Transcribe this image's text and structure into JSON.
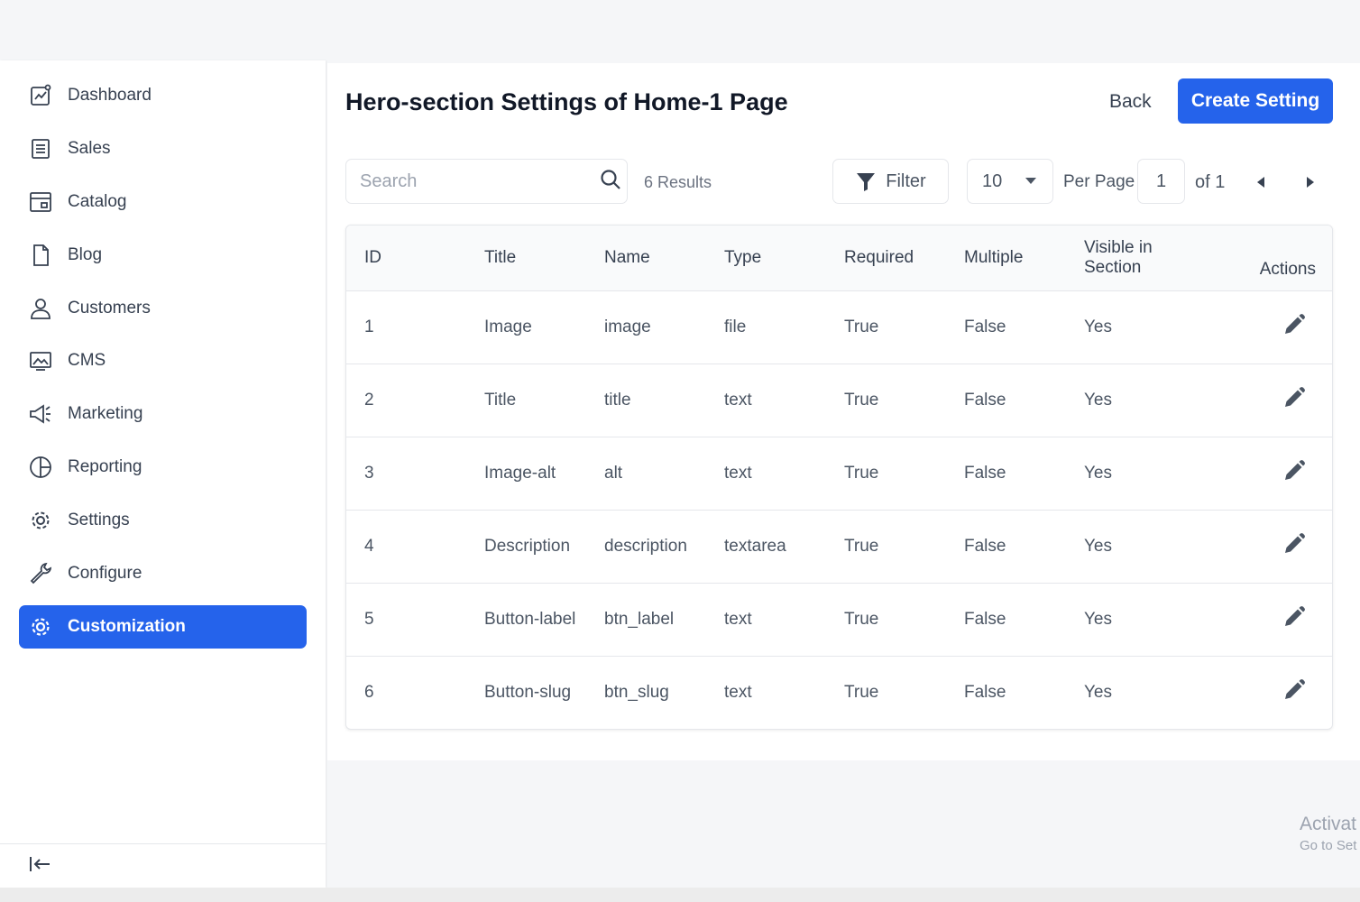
{
  "sidebar": {
    "items": [
      {
        "label": "Dashboard",
        "icon": "dashboard-chart-icon"
      },
      {
        "label": "Sales",
        "icon": "document-list-icon"
      },
      {
        "label": "Catalog",
        "icon": "catalog-window-icon"
      },
      {
        "label": "Blog",
        "icon": "blank-file-icon"
      },
      {
        "label": "Customers",
        "icon": "user-icon"
      },
      {
        "label": "CMS",
        "icon": "image-monitor-icon"
      },
      {
        "label": "Marketing",
        "icon": "megaphone-icon"
      },
      {
        "label": "Reporting",
        "icon": "pie-chart-icon"
      },
      {
        "label": "Settings",
        "icon": "gear-icon"
      },
      {
        "label": "Configure",
        "icon": "wrench-icon"
      },
      {
        "label": "Customization",
        "icon": "gear-icon",
        "active": true
      }
    ],
    "collapse_icon": "collapse-left-icon"
  },
  "header": {
    "title": "Hero-section Settings of Home-1 Page",
    "back_label": "Back",
    "create_label": "Create Setting"
  },
  "toolbar": {
    "search_placeholder": "Search",
    "results": "6 Results",
    "filter_label": "Filter",
    "per_page_value": "10",
    "per_page_label": "Per Page",
    "current_page": "1",
    "page_of": "of 1"
  },
  "table": {
    "columns": [
      "ID",
      "Title",
      "Name",
      "Type",
      "Required",
      "Multiple",
      "Visible in Section",
      "Actions"
    ],
    "rows": [
      [
        "1",
        "Image",
        "image",
        "file",
        "True",
        "False",
        "Yes"
      ],
      [
        "2",
        "Title",
        "title",
        "text",
        "True",
        "False",
        "Yes"
      ],
      [
        "3",
        "Image-alt",
        "alt",
        "text",
        "True",
        "False",
        "Yes"
      ],
      [
        "4",
        "Description",
        "description",
        "textarea",
        "True",
        "False",
        "Yes"
      ],
      [
        "5",
        "Button-label",
        "btn_label",
        "text",
        "True",
        "False",
        "Yes"
      ],
      [
        "6",
        "Button-slug",
        "btn_slug",
        "text",
        "True",
        "False",
        "Yes"
      ]
    ]
  },
  "watermark": {
    "line1": "Activat",
    "line2": "Go to Set"
  },
  "colors": {
    "accent": "#2563eb",
    "text": "#374151"
  }
}
